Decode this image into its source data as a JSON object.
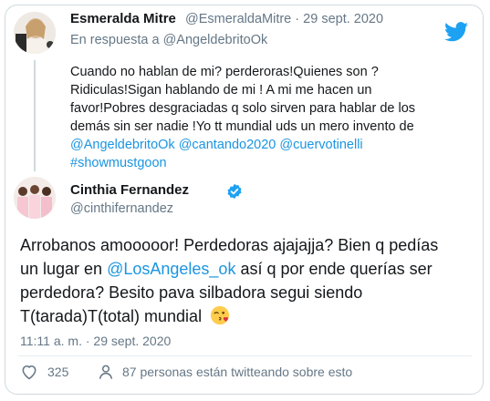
{
  "reply_tweet": {
    "display_name": "Esmeralda Mitre",
    "handle": "@EsmeraldaMitre",
    "separator": "·",
    "date": "29 sept. 2020",
    "reply_prefix": "En respuesta a",
    "reply_to": "@AngeldebritoOk",
    "text_lines": [
      "Cuando no hablan de mi? perderoras!Quienes  son ?",
      "Ridiculas!Sigan hablando  de mi ! A mi me hacen un",
      "favor!Pobres desgraciadas q solo sirven para hablar de los",
      "demás sin ser nadie !Yo tt mundial uds un mero invento de"
    ],
    "mentions": [
      "@AngeldebritoOk",
      "@cantando2020",
      "@cuervotinelli"
    ],
    "hashtag": "#showmustgoon"
  },
  "main_tweet": {
    "display_name": "Cinthia Fernandez",
    "handle": "@cinthifernandez",
    "line1": "Arrobanos amooooor! Perdedoras ajajajja? Bien q pedías",
    "line2_pre": "un lugar en ",
    "line2_mention": "@LosAngeles_ok",
    "line2_post": " así q por ende querías ser",
    "line3": "perdedora? Besito pava silbadora segui siendo",
    "line4": "T(tarada)T(total) mundial",
    "emoji": "face-throwing-kiss-emoji",
    "time": "11:11 a. m.",
    "separator": "·",
    "date": "29 sept. 2020"
  },
  "actions": {
    "likes": "325",
    "talking": "87 personas están twitteando sobre esto"
  },
  "icons": {
    "brand": "twitter-bird-icon",
    "verified": "verified-badge-icon",
    "like": "heart-icon",
    "talking": "person-icon"
  },
  "colors": {
    "link": "#1b95e0",
    "muted": "#657786",
    "twitter_blue": "#1da1f2",
    "text": "#14171a"
  }
}
